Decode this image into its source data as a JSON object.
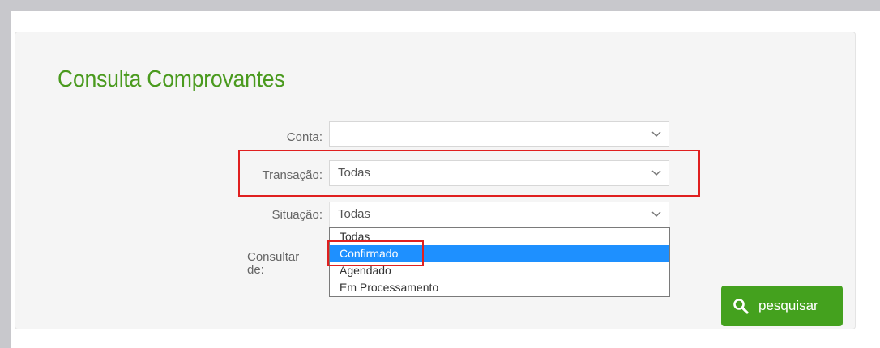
{
  "page": {
    "title": "Consulta Comprovantes"
  },
  "form": {
    "conta_label": "Conta:",
    "conta_value": "",
    "transacao_label": "Transação:",
    "transacao_value": "Todas",
    "situacao_label": "Situação:",
    "situacao_value": "Todas",
    "consultar_label_line1": "Consultar",
    "consultar_label_line2": "de:"
  },
  "situacao_dropdown": {
    "options": [
      "Todas",
      "Confirmado",
      "Agendado",
      "Em Processamento"
    ],
    "highlighted_index": 1
  },
  "actions": {
    "search_label": "pesquisar"
  },
  "colors": {
    "title_green": "#4a9a1e",
    "button_green": "#44a11e",
    "selected_option_blue": "#1e90ff",
    "annotation_red": "#e02020"
  }
}
